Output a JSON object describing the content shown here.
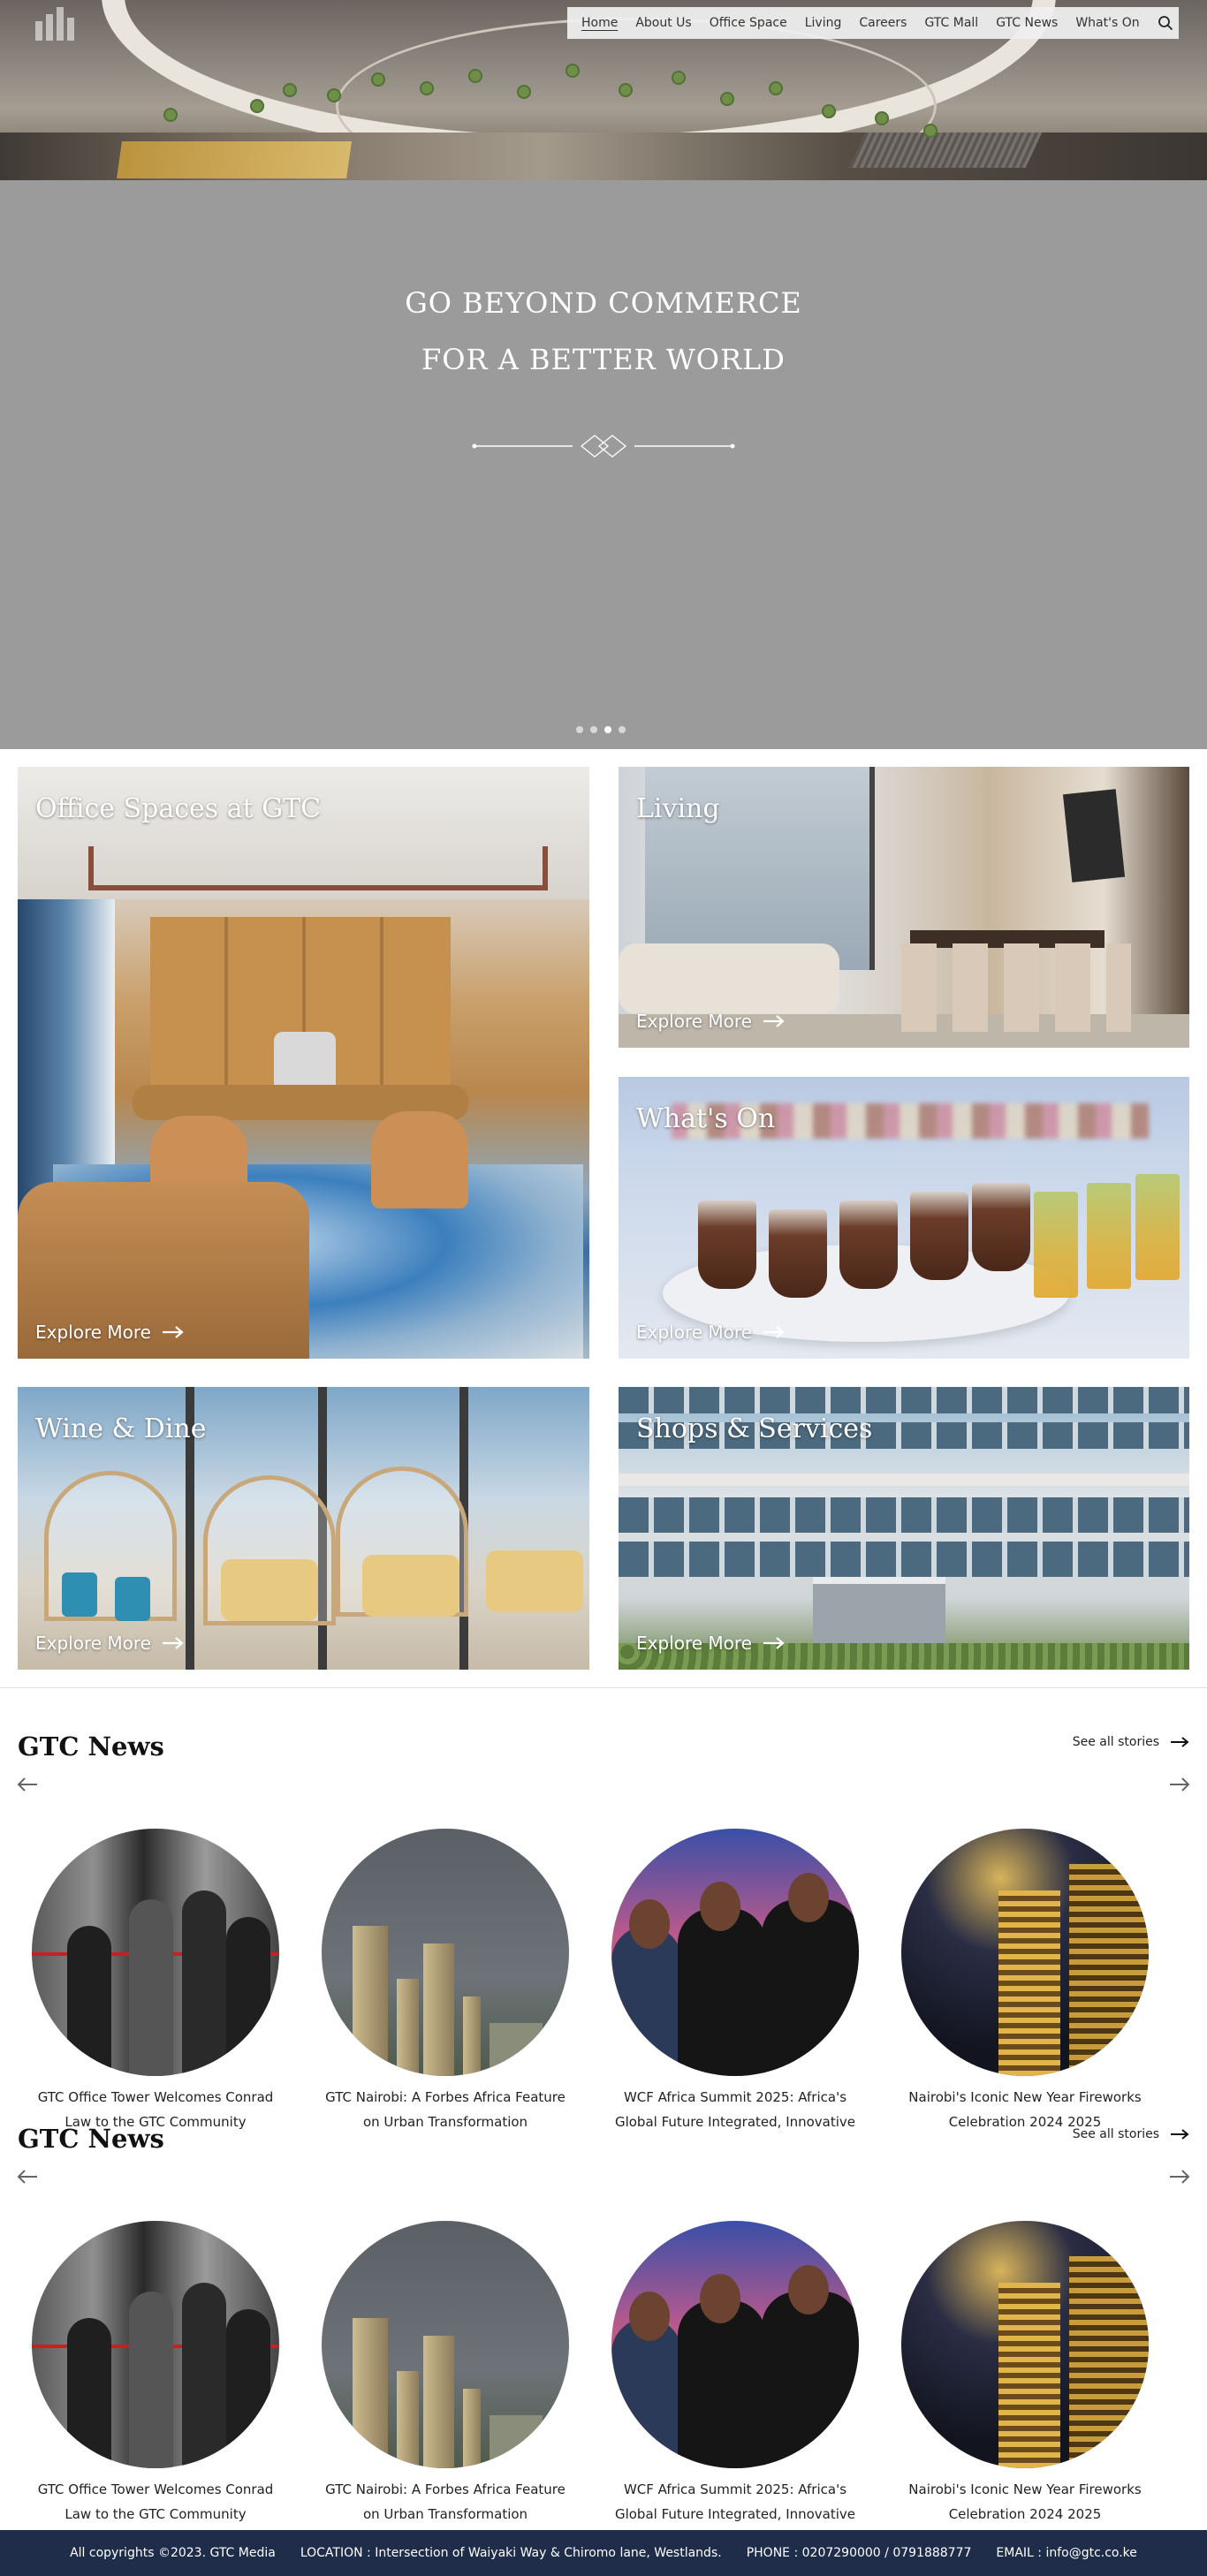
{
  "nav": {
    "items": [
      "Home",
      "About Us",
      "Office Space",
      "Living",
      "Careers",
      "GTC Mall",
      "GTC News",
      "What's On"
    ],
    "active": "Home",
    "search_icon": "search-icon"
  },
  "hero": {
    "line1": "GO BEYOND COMMERCE",
    "line2": "FOR A BETTER WORLD",
    "slide_count": 4,
    "active_slide": 3
  },
  "tiles": [
    {
      "title": "Office Spaces at GTC",
      "cta": "Explore More"
    },
    {
      "title": "Living",
      "cta": "Explore More"
    },
    {
      "title": "What's On",
      "cta": "Explore More"
    },
    {
      "title": "Wine & Dine",
      "cta": "Explore More"
    },
    {
      "title": "Shops & Services",
      "cta": "Explore More"
    }
  ],
  "news": {
    "heading": "GTC News",
    "see_all": "See all stories",
    "items": [
      {
        "line1": "GTC Office Tower Welcomes Conrad",
        "line2": "Law to the GTC Community"
      },
      {
        "line1": "GTC Nairobi: A Forbes Africa Feature",
        "line2": "on Urban Transformation"
      },
      {
        "line1": "WCF Africa Summit 2025: Africa's",
        "line2": "Global Future Integrated, Innovative"
      },
      {
        "line1": "Nairobi's Iconic New Year Fireworks",
        "line2": "Celebration 2024 2025"
      }
    ]
  },
  "footer": {
    "copyright": "All copyrights ©2023. GTC Media",
    "location": "LOCATION :  Intersection of Waiyaki Way & Chiromo lane, Westlands.",
    "phone": "PHONE :  0207290000 / 0791888777",
    "email": "EMAIL : info@gtc.co.ke"
  },
  "colors": {
    "footer_bg": "#1f2d4a",
    "hero_bg": "#9b9b9b",
    "nav_bg": "#f0f0f0"
  }
}
